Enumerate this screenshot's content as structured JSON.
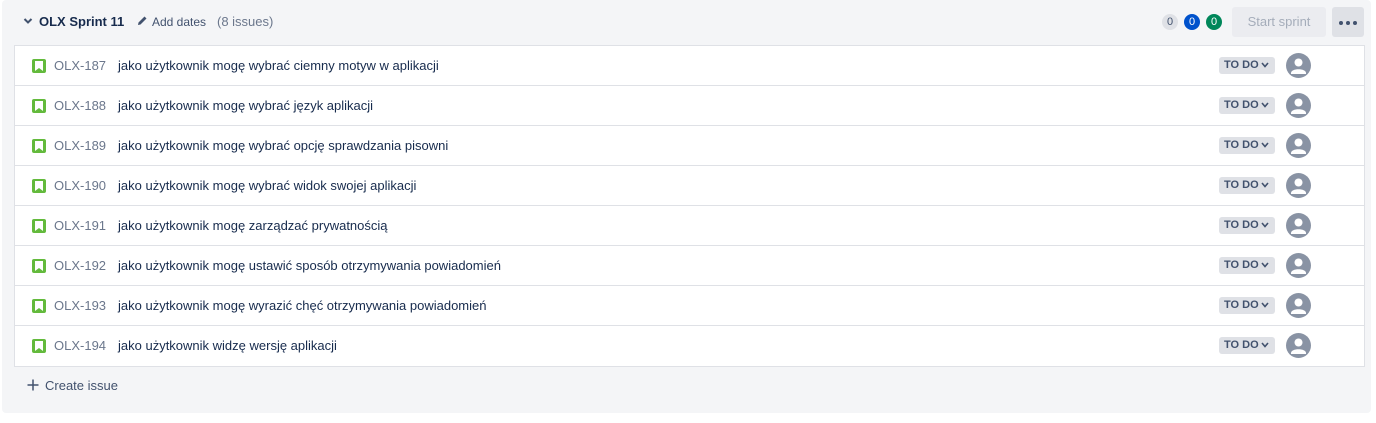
{
  "sprint": {
    "name": "OLX Sprint 11",
    "add_dates_label": "Add dates",
    "issue_count_label": "(8 issues)",
    "counts": {
      "todo": "0",
      "in_progress": "0",
      "done": "0"
    },
    "start_sprint_label": "Start sprint",
    "create_issue_label": "Create issue"
  },
  "issues": [
    {
      "key": "OLX-187",
      "summary": "jako użytkownik mogę wybrać ciemny motyw w aplikacji",
      "status": "TO DO"
    },
    {
      "key": "OLX-188",
      "summary": "jako użytkownik mogę wybrać język aplikacji",
      "status": "TO DO"
    },
    {
      "key": "OLX-189",
      "summary": "jako użytkownik mogę wybrać opcję sprawdzania pisowni",
      "status": "TO DO"
    },
    {
      "key": "OLX-190",
      "summary": "jako użytkownik mogę wybrać widok swojej aplikacji",
      "status": "TO DO"
    },
    {
      "key": "OLX-191",
      "summary": "jako użytkownik mogę zarządzać prywatnością",
      "status": "TO DO"
    },
    {
      "key": "OLX-192",
      "summary": "jako użytkownik mogę ustawić sposób otrzymywania powiadomień",
      "status": "TO DO"
    },
    {
      "key": "OLX-193",
      "summary": "jako użytkownik mogę wyrazić chęć otrzymywania powiadomień",
      "status": "TO DO"
    },
    {
      "key": "OLX-194",
      "summary": "jako użytkownik widzę wersję aplikacji",
      "status": "TO DO"
    }
  ],
  "icons": {
    "collapse": "chevron-down-icon",
    "edit": "pencil-icon",
    "more": "more-horizontal-icon",
    "issue_type": "story-bookmark-icon",
    "status_dropdown": "chevron-down-icon",
    "assignee": "default-avatar-icon",
    "create": "plus-icon"
  },
  "colors": {
    "story": "#63ba3c",
    "in_progress": "#0052cc",
    "done": "#00875a",
    "status_bg": "#dfe1e6"
  }
}
